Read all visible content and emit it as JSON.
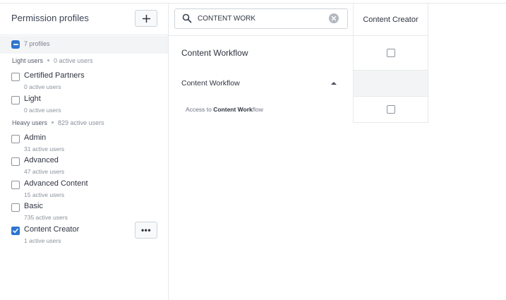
{
  "sidebar": {
    "title": "Permission profiles",
    "summary": "7 profiles",
    "groups": [
      {
        "name": "Light users",
        "count": "0 active users"
      },
      {
        "name": "Heavy users",
        "count": "829 active users"
      }
    ],
    "items": [
      {
        "label": "Certified Partners",
        "sub": "0 active users",
        "checked": false
      },
      {
        "label": "Light",
        "sub": "0 active users",
        "checked": false
      },
      {
        "label": "Admin",
        "sub": "31 active users",
        "checked": false
      },
      {
        "label": "Advanced",
        "sub": "47 active users",
        "checked": false
      },
      {
        "label": "Advanced Content",
        "sub": "15 active users",
        "checked": false
      },
      {
        "label": "Basic",
        "sub": "735 active users",
        "checked": false
      },
      {
        "label": "Content Creator",
        "sub": "1 active users",
        "checked": true
      }
    ],
    "more_button": "•••"
  },
  "search": {
    "value": "CONTENT WORK"
  },
  "main": {
    "section_title": "Content Workflow",
    "sub_title": "Content Workflow",
    "permission": {
      "prefix": "Access to ",
      "match": "Content Work",
      "suffix": "flow"
    }
  },
  "column": {
    "header": "Content Creator"
  },
  "colors": {
    "accent": "#2f74d0",
    "border": "#e6e8eb"
  }
}
